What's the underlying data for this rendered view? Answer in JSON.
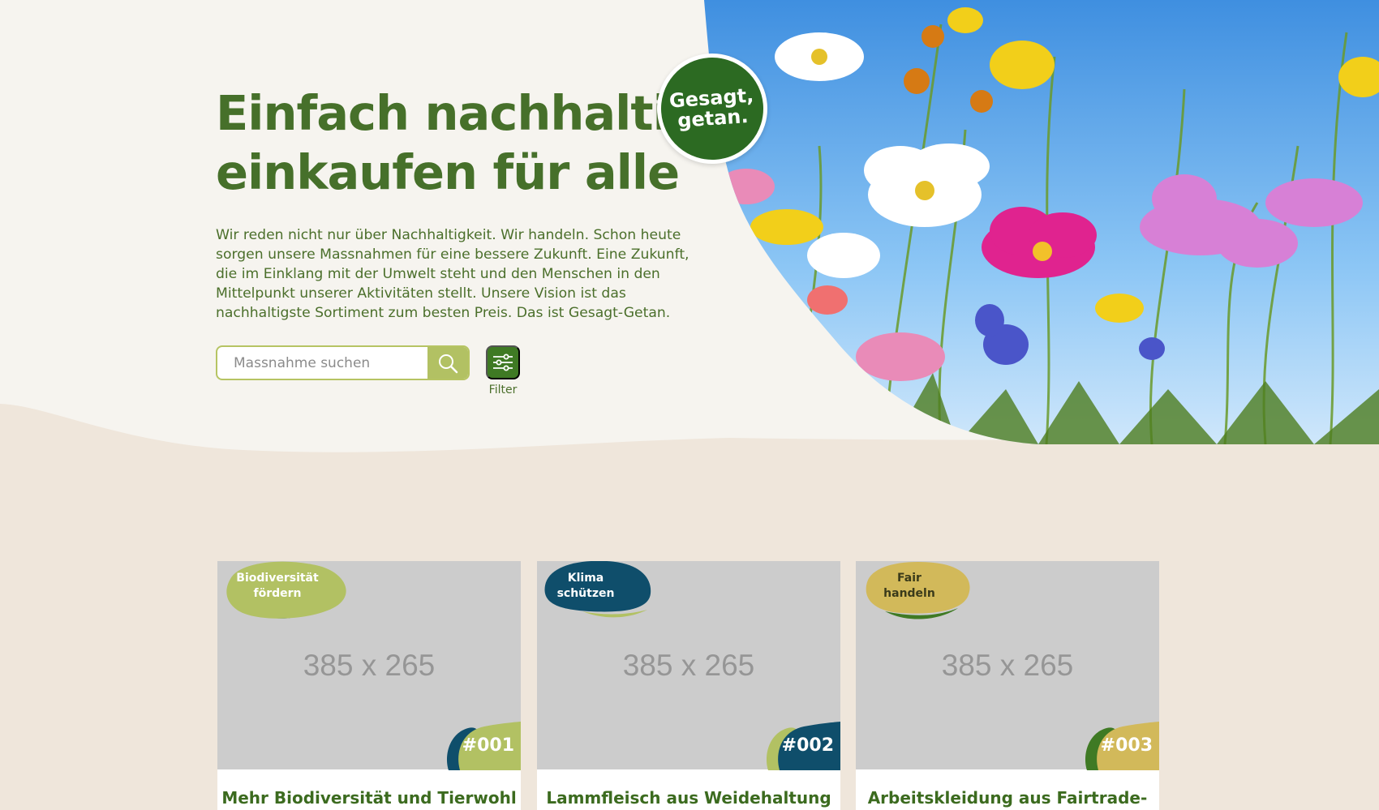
{
  "hero": {
    "headline_line1": "Einfach nachhaltig",
    "headline_line2": "einkaufen für alle",
    "intro": "Wir reden nicht nur über Nachhaltigkeit. Wir handeln. Schon heute sorgen unsere Massnahmen für eine bessere Zukunft. Eine Zukunft, die im Einklang mit der Umwelt steht und den Menschen in den Mittelpunkt unserer Aktivitäten stellt. Unsere Vision ist das nachhaltigste Sortiment zum besten Preis. Das ist Gesagt-Getan.",
    "badge_line1": "Gesagt,",
    "badge_line2": "getan.",
    "search_placeholder": "Massnahme suchen",
    "filter_label": "Filter"
  },
  "colors": {
    "brand_green": "#3f7a24",
    "headline_green": "#46702a",
    "olive": "#b2c163",
    "teal": "#0f4e6b",
    "mustard": "#d2b95a",
    "hero_bg": "#f6f4ef",
    "section_bg": "#efe6db"
  },
  "cards": [
    {
      "tag_line1": "Biodiversität",
      "tag_line2": "fördern",
      "placeholder": "385 x 265",
      "number": "#001",
      "title": "Mehr Biodiversität und Tierwohl"
    },
    {
      "tag_line1": "Klima",
      "tag_line2": "schützen",
      "placeholder": "385 x 265",
      "number": "#002",
      "title": "Lammfleisch aus Weidehaltung"
    },
    {
      "tag_line1": "Fair",
      "tag_line2": "handeln",
      "placeholder": "385 x 265",
      "number": "#003",
      "title": "Arbeitskleidung aus Fairtrade-"
    }
  ]
}
